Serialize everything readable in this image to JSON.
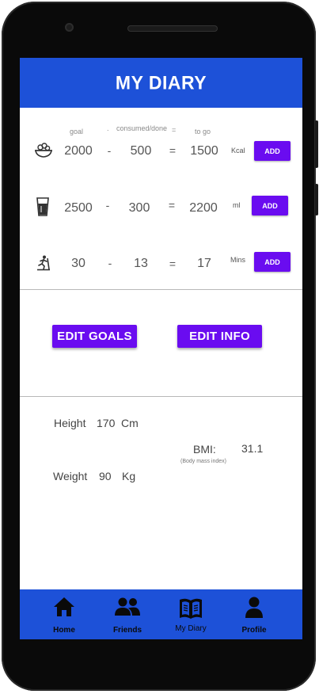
{
  "header": {
    "title": "MY  DIARY"
  },
  "columns": {
    "goal": "goal",
    "consumed": "consumed/done",
    "to_go": "to go"
  },
  "rows": [
    {
      "icon": "food-bowl-icon",
      "goal": "2000",
      "minus": "-",
      "consumed": "500",
      "equals": "=",
      "to_go": "1500",
      "unit": "Kcal",
      "add_label": "ADD"
    },
    {
      "icon": "water-glass-icon",
      "goal": "2500",
      "minus": "-",
      "consumed": "300",
      "equals": "=",
      "to_go": "2200",
      "unit": "ml",
      "add_label": "ADD"
    },
    {
      "icon": "treadmill-icon",
      "goal": "30",
      "minus": "-",
      "consumed": "13",
      "equals": "=",
      "to_go": "17",
      "unit": "Mins",
      "add_label": "ADD"
    }
  ],
  "actions": {
    "edit_goals": "EDIT GOALS",
    "edit_info": "EDIT INFO"
  },
  "info": {
    "height_label": "Height",
    "height_value": "170",
    "height_unit": "Cm",
    "weight_label": "Weight",
    "weight_value": "90",
    "weight_unit": "Kg",
    "bmi_label": "BMI:",
    "bmi_note": "(Body mass index)",
    "bmi_value": "31.1"
  },
  "nav": [
    {
      "label": "Home",
      "icon": "home-icon"
    },
    {
      "label": "Friends",
      "icon": "friends-icon"
    },
    {
      "label": "My Diary",
      "icon": "book-icon"
    },
    {
      "label": "Profile",
      "icon": "profile-icon"
    }
  ],
  "colors": {
    "primary": "#1d51d8",
    "accent": "#6a0cf0"
  }
}
